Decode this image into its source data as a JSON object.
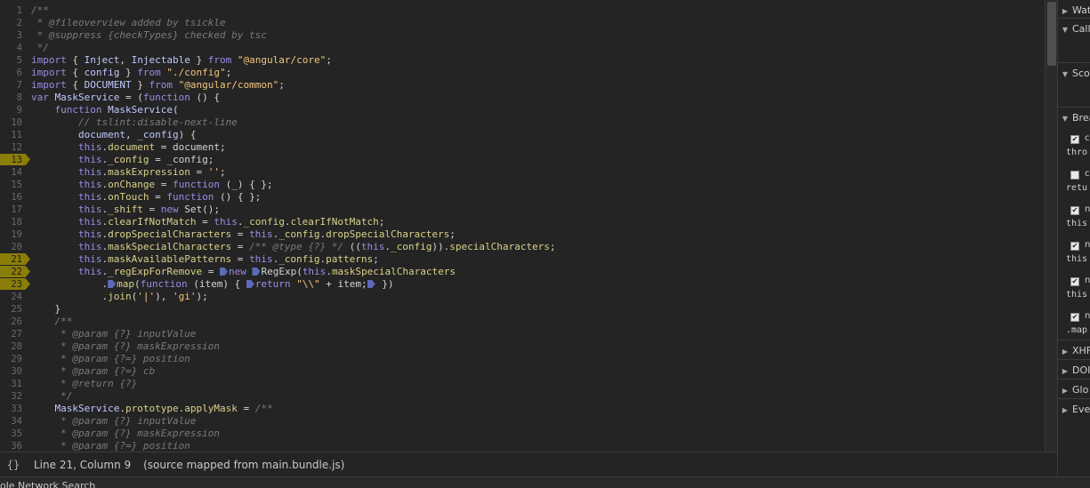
{
  "editor": {
    "lines": [
      {
        "n": "1",
        "bp": false,
        "tokens": [
          {
            "c": "cm",
            "t": "/**"
          }
        ]
      },
      {
        "n": "2",
        "bp": false,
        "tokens": [
          {
            "c": "cm",
            "t": " * @fileoverview added by tsickle"
          }
        ]
      },
      {
        "n": "3",
        "bp": false,
        "tokens": [
          {
            "c": "cm",
            "t": " * @suppress {checkTypes} checked by tsc"
          }
        ]
      },
      {
        "n": "4",
        "bp": false,
        "tokens": [
          {
            "c": "cm",
            "t": " */"
          }
        ]
      },
      {
        "n": "5",
        "bp": false,
        "tokens": [
          {
            "c": "kw",
            "t": "import"
          },
          {
            "c": "pl",
            "t": " { "
          },
          {
            "c": "id",
            "t": "Inject"
          },
          {
            "c": "pl",
            "t": ", "
          },
          {
            "c": "id",
            "t": "Injectable"
          },
          {
            "c": "pl",
            "t": " } "
          },
          {
            "c": "kw",
            "t": "from"
          },
          {
            "c": "pl",
            "t": " "
          },
          {
            "c": "st",
            "t": "\"@angular/core\""
          },
          {
            "c": "pl",
            "t": ";"
          }
        ]
      },
      {
        "n": "6",
        "bp": false,
        "tokens": [
          {
            "c": "kw",
            "t": "import"
          },
          {
            "c": "pl",
            "t": " { "
          },
          {
            "c": "id",
            "t": "config"
          },
          {
            "c": "pl",
            "t": " } "
          },
          {
            "c": "kw",
            "t": "from"
          },
          {
            "c": "pl",
            "t": " "
          },
          {
            "c": "st",
            "t": "\"./config\""
          },
          {
            "c": "pl",
            "t": ";"
          }
        ]
      },
      {
        "n": "7",
        "bp": false,
        "tokens": [
          {
            "c": "kw",
            "t": "import"
          },
          {
            "c": "pl",
            "t": " { "
          },
          {
            "c": "id",
            "t": "DOCUMENT"
          },
          {
            "c": "pl",
            "t": " } "
          },
          {
            "c": "kw",
            "t": "from"
          },
          {
            "c": "pl",
            "t": " "
          },
          {
            "c": "st",
            "t": "\"@angular/common\""
          },
          {
            "c": "pl",
            "t": ";"
          }
        ]
      },
      {
        "n": "8",
        "bp": false,
        "tokens": [
          {
            "c": "kw",
            "t": "var"
          },
          {
            "c": "pl",
            "t": " "
          },
          {
            "c": "id",
            "t": "MaskService"
          },
          {
            "c": "pl",
            "t": " = ("
          },
          {
            "c": "kw",
            "t": "function"
          },
          {
            "c": "pl",
            "t": " () {"
          }
        ]
      },
      {
        "n": "9",
        "bp": false,
        "tokens": [
          {
            "c": "pl",
            "t": "    "
          },
          {
            "c": "kw",
            "t": "function"
          },
          {
            "c": "pl",
            "t": " "
          },
          {
            "c": "id",
            "t": "MaskService"
          },
          {
            "c": "pl",
            "t": "("
          }
        ]
      },
      {
        "n": "10",
        "bp": false,
        "tokens": [
          {
            "c": "cm",
            "t": "        // tslint:disable-next-line"
          }
        ]
      },
      {
        "n": "11",
        "bp": false,
        "tokens": [
          {
            "c": "pl",
            "t": "        "
          },
          {
            "c": "id",
            "t": "document"
          },
          {
            "c": "pl",
            "t": ", "
          },
          {
            "c": "id",
            "t": "_config"
          },
          {
            "c": "pl",
            "t": ") {"
          }
        ]
      },
      {
        "n": "12",
        "bp": false,
        "tokens": [
          {
            "c": "pl",
            "t": "        "
          },
          {
            "c": "kw",
            "t": "this"
          },
          {
            "c": "pl",
            "t": "."
          },
          {
            "c": "pr",
            "t": "document"
          },
          {
            "c": "pl",
            "t": " = document;"
          }
        ]
      },
      {
        "n": "13",
        "bp": true,
        "tokens": [
          {
            "c": "pl",
            "t": "        "
          },
          {
            "c": "kw",
            "t": "this"
          },
          {
            "c": "pl",
            "t": "."
          },
          {
            "c": "pr",
            "t": "_config"
          },
          {
            "c": "pl",
            "t": " = _config;"
          }
        ]
      },
      {
        "n": "14",
        "bp": false,
        "tokens": [
          {
            "c": "pl",
            "t": "        "
          },
          {
            "c": "kw",
            "t": "this"
          },
          {
            "c": "pl",
            "t": "."
          },
          {
            "c": "pr",
            "t": "maskExpression"
          },
          {
            "c": "pl",
            "t": " = "
          },
          {
            "c": "st",
            "t": "''"
          },
          {
            "c": "pl",
            "t": ";"
          }
        ]
      },
      {
        "n": "15",
        "bp": false,
        "tokens": [
          {
            "c": "pl",
            "t": "        "
          },
          {
            "c": "kw",
            "t": "this"
          },
          {
            "c": "pl",
            "t": "."
          },
          {
            "c": "pr",
            "t": "onChange"
          },
          {
            "c": "pl",
            "t": " = "
          },
          {
            "c": "kw",
            "t": "function"
          },
          {
            "c": "pl",
            "t": " (_) { };"
          }
        ]
      },
      {
        "n": "16",
        "bp": false,
        "tokens": [
          {
            "c": "pl",
            "t": "        "
          },
          {
            "c": "kw",
            "t": "this"
          },
          {
            "c": "pl",
            "t": "."
          },
          {
            "c": "pr",
            "t": "onTouch"
          },
          {
            "c": "pl",
            "t": " = "
          },
          {
            "c": "kw",
            "t": "function"
          },
          {
            "c": "pl",
            "t": " () { };"
          }
        ]
      },
      {
        "n": "17",
        "bp": false,
        "tokens": [
          {
            "c": "pl",
            "t": "        "
          },
          {
            "c": "kw",
            "t": "this"
          },
          {
            "c": "pl",
            "t": "."
          },
          {
            "c": "pr",
            "t": "_shift"
          },
          {
            "c": "pl",
            "t": " = "
          },
          {
            "c": "kw",
            "t": "new"
          },
          {
            "c": "pl",
            "t": " Set();"
          }
        ]
      },
      {
        "n": "18",
        "bp": false,
        "tokens": [
          {
            "c": "pl",
            "t": "        "
          },
          {
            "c": "kw",
            "t": "this"
          },
          {
            "c": "pl",
            "t": "."
          },
          {
            "c": "pr",
            "t": "clearIfNotMatch"
          },
          {
            "c": "pl",
            "t": " = "
          },
          {
            "c": "kw",
            "t": "this"
          },
          {
            "c": "pl",
            "t": "."
          },
          {
            "c": "pr",
            "t": "_config"
          },
          {
            "c": "pl",
            "t": "."
          },
          {
            "c": "pr",
            "t": "clearIfNotMatch"
          },
          {
            "c": "pl",
            "t": ";"
          }
        ]
      },
      {
        "n": "19",
        "bp": false,
        "tokens": [
          {
            "c": "pl",
            "t": "        "
          },
          {
            "c": "kw",
            "t": "this"
          },
          {
            "c": "pl",
            "t": "."
          },
          {
            "c": "pr",
            "t": "dropSpecialCharacters"
          },
          {
            "c": "pl",
            "t": " = "
          },
          {
            "c": "kw",
            "t": "this"
          },
          {
            "c": "pl",
            "t": "."
          },
          {
            "c": "pr",
            "t": "_config"
          },
          {
            "c": "pl",
            "t": "."
          },
          {
            "c": "pr",
            "t": "dropSpecialCharacters"
          },
          {
            "c": "pl",
            "t": ";"
          }
        ]
      },
      {
        "n": "20",
        "bp": false,
        "tokens": [
          {
            "c": "pl",
            "t": "        "
          },
          {
            "c": "kw",
            "t": "this"
          },
          {
            "c": "pl",
            "t": "."
          },
          {
            "c": "pr",
            "t": "maskSpecialCharacters"
          },
          {
            "c": "pl",
            "t": " = "
          },
          {
            "c": "cm",
            "t": "/** @type {?} */"
          },
          {
            "c": "pl",
            "t": " (("
          },
          {
            "c": "kw",
            "t": "this"
          },
          {
            "c": "pl",
            "t": "."
          },
          {
            "c": "pr",
            "t": "_config"
          },
          {
            "c": "pl",
            "t": "))."
          },
          {
            "c": "pr",
            "t": "specialCharacters"
          },
          {
            "c": "pl",
            "t": ";"
          }
        ]
      },
      {
        "n": "21",
        "bp": true,
        "tokens": [
          {
            "c": "pl",
            "t": "        "
          },
          {
            "c": "kw",
            "t": "this"
          },
          {
            "c": "pl",
            "t": "."
          },
          {
            "c": "pr",
            "t": "maskAvailablePatterns"
          },
          {
            "c": "pl",
            "t": " = "
          },
          {
            "c": "kw",
            "t": "this"
          },
          {
            "c": "pl",
            "t": "."
          },
          {
            "c": "pr",
            "t": "_config"
          },
          {
            "c": "pl",
            "t": "."
          },
          {
            "c": "pr",
            "t": "patterns"
          },
          {
            "c": "pl",
            "t": ";"
          }
        ]
      },
      {
        "n": "22",
        "bp": true,
        "tokens": [
          {
            "c": "pl",
            "t": "        "
          },
          {
            "c": "kw",
            "t": "this"
          },
          {
            "c": "pl",
            "t": "."
          },
          {
            "c": "pr",
            "t": "_regExpForRemove"
          },
          {
            "c": "pl",
            "t": " = "
          },
          {
            "c": "bm",
            "t": ""
          },
          {
            "c": "kw",
            "t": "new"
          },
          {
            "c": "pl",
            "t": " "
          },
          {
            "c": "bm",
            "t": ""
          },
          {
            "c": "pl",
            "t": "RegExp("
          },
          {
            "c": "kw",
            "t": "this"
          },
          {
            "c": "pl",
            "t": "."
          },
          {
            "c": "pr",
            "t": "maskSpecialCharacters"
          }
        ]
      },
      {
        "n": "23",
        "bp": true,
        "tokens": [
          {
            "c": "pl",
            "t": "            ."
          },
          {
            "c": "bm",
            "t": ""
          },
          {
            "c": "pr",
            "t": "map"
          },
          {
            "c": "pl",
            "t": "("
          },
          {
            "c": "kw",
            "t": "function"
          },
          {
            "c": "pl",
            "t": " (item) { "
          },
          {
            "c": "bm",
            "t": ""
          },
          {
            "c": "kw",
            "t": "return"
          },
          {
            "c": "pl",
            "t": " "
          },
          {
            "c": "st",
            "t": "\"\\\\\""
          },
          {
            "c": "pl",
            "t": " + item;"
          },
          {
            "c": "bm",
            "t": ""
          },
          {
            "c": "pl",
            "t": " })"
          }
        ]
      },
      {
        "n": "24",
        "bp": false,
        "tokens": [
          {
            "c": "pl",
            "t": "            ."
          },
          {
            "c": "pr",
            "t": "join"
          },
          {
            "c": "pl",
            "t": "("
          },
          {
            "c": "st",
            "t": "'|'"
          },
          {
            "c": "pl",
            "t": "), "
          },
          {
            "c": "st",
            "t": "'gi'"
          },
          {
            "c": "pl",
            "t": ");"
          }
        ]
      },
      {
        "n": "25",
        "bp": false,
        "tokens": [
          {
            "c": "pl",
            "t": "    }"
          }
        ]
      },
      {
        "n": "26",
        "bp": false,
        "tokens": [
          {
            "c": "cm",
            "t": "    /**"
          }
        ]
      },
      {
        "n": "27",
        "bp": false,
        "tokens": [
          {
            "c": "cm",
            "t": "     * @param {?} inputValue"
          }
        ]
      },
      {
        "n": "28",
        "bp": false,
        "tokens": [
          {
            "c": "cm",
            "t": "     * @param {?} maskExpression"
          }
        ]
      },
      {
        "n": "29",
        "bp": false,
        "tokens": [
          {
            "c": "cm",
            "t": "     * @param {?=} position"
          }
        ]
      },
      {
        "n": "30",
        "bp": false,
        "tokens": [
          {
            "c": "cm",
            "t": "     * @param {?=} cb"
          }
        ]
      },
      {
        "n": "31",
        "bp": false,
        "tokens": [
          {
            "c": "cm",
            "t": "     * @return {?}"
          }
        ]
      },
      {
        "n": "32",
        "bp": false,
        "tokens": [
          {
            "c": "cm",
            "t": "     */"
          }
        ]
      },
      {
        "n": "33",
        "bp": false,
        "tokens": [
          {
            "c": "pl",
            "t": "    "
          },
          {
            "c": "id",
            "t": "MaskService"
          },
          {
            "c": "pl",
            "t": "."
          },
          {
            "c": "pr",
            "t": "prototype"
          },
          {
            "c": "pl",
            "t": "."
          },
          {
            "c": "pr",
            "t": "applyMask"
          },
          {
            "c": "pl",
            "t": " = "
          },
          {
            "c": "cm",
            "t": "/**"
          }
        ]
      },
      {
        "n": "34",
        "bp": false,
        "tokens": [
          {
            "c": "cm",
            "t": "     * @param {?} inputValue"
          }
        ]
      },
      {
        "n": "35",
        "bp": false,
        "tokens": [
          {
            "c": "cm",
            "t": "     * @param {?} maskExpression"
          }
        ]
      },
      {
        "n": "36",
        "bp": false,
        "tokens": [
          {
            "c": "cm",
            "t": "     * @param {?=} position"
          }
        ]
      }
    ]
  },
  "status": {
    "braces": "{}",
    "cursor_position": "Line 21, Column 9",
    "source_note": "(source mapped from main.bundle.js)"
  },
  "drawer": {
    "text": "ole  Network  Search"
  },
  "sidebar": {
    "sections_top": [
      {
        "label": "Wat",
        "open": false
      },
      {
        "label": "Call",
        "open": true
      },
      {
        "label": "Sco",
        "open": true
      },
      {
        "label": "Brea",
        "open": true
      }
    ],
    "breakpoints": [
      {
        "checked": true,
        "label": "c",
        "code": "thro"
      },
      {
        "checked": false,
        "label": "c",
        "code": "retu"
      },
      {
        "checked": true,
        "label": "n",
        "code": "this"
      },
      {
        "checked": true,
        "label": "n",
        "code": "this"
      },
      {
        "checked": true,
        "label": "n",
        "code": "this"
      },
      {
        "checked": true,
        "label": "n",
        "code": ".map"
      }
    ],
    "sections_bottom": [
      {
        "label": "XHF",
        "open": false
      },
      {
        "label": "DOI",
        "open": false
      },
      {
        "label": "Glo",
        "open": false
      },
      {
        "label": "Eve",
        "open": false
      }
    ]
  },
  "colors": {
    "background": "#242424",
    "breakpoint_marker": "#8b7e08",
    "inline_breakpoint": "#5d6ab8"
  }
}
